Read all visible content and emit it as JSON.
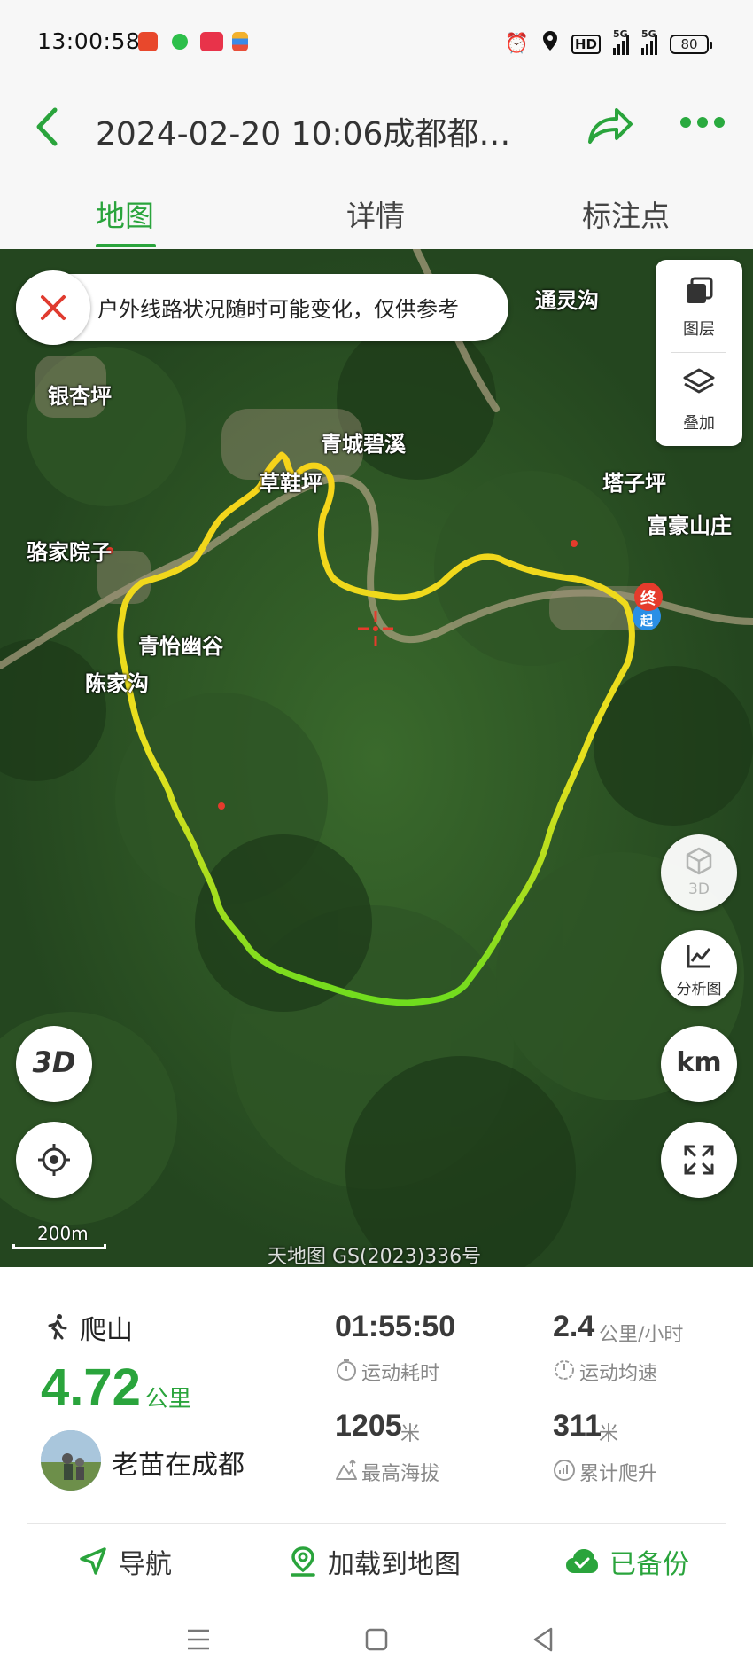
{
  "status_bar": {
    "time": "13:00:58",
    "battery": "80",
    "signal_1": "5G",
    "signal_2": "5G",
    "hd_badge": "HD"
  },
  "header": {
    "title": "2024-02-20 10:06成都都…",
    "back_icon": "chevron-left-icon",
    "share_icon": "share-arrow-icon",
    "more_icon": "more-dots-icon",
    "accent_color": "#2aa43c"
  },
  "tabs": [
    {
      "label": "地图",
      "active": true
    },
    {
      "label": "详情",
      "active": false
    },
    {
      "label": "标注点",
      "active": false
    }
  ],
  "map": {
    "notice": "户外线路状况随时可能变化，仅供参考",
    "layer_panel": {
      "layers_label": "图层",
      "overlay_label": "叠加"
    },
    "places": [
      "通灵沟",
      "银杏坪",
      "青城碧溪",
      "草鞋坪",
      "塔子坪",
      "富豪山庄",
      "骆家院子",
      "青怡幽谷",
      "陈家沟"
    ],
    "buttons": {
      "3d_label": "3D",
      "analysis_label": "分析图",
      "km_label": "km",
      "btn_3d_text": "3D"
    },
    "markers": {
      "end": "终",
      "start": "起"
    },
    "scale": "200m",
    "watermark": "天地图 GS(2023)336号"
  },
  "activity": {
    "type": "爬山",
    "distance": "4.72",
    "distance_unit": "公里",
    "user": "老苗在成都",
    "stats": [
      {
        "value": "01:55:50",
        "unit": "",
        "label": "运动耗时",
        "icon": "stopwatch-icon"
      },
      {
        "value": "2.4",
        "unit": "公里/小时",
        "label": "运动均速",
        "icon": "speed-icon"
      },
      {
        "value": "1205",
        "unit": "米",
        "label": "最高海拔",
        "icon": "mountain-icon"
      },
      {
        "value": "311",
        "unit": "米",
        "label": "累计爬升",
        "icon": "climb-icon"
      }
    ]
  },
  "actions": {
    "navigate": "导航",
    "load_to_map": "加载到地图",
    "backed_up": "已备份"
  }
}
